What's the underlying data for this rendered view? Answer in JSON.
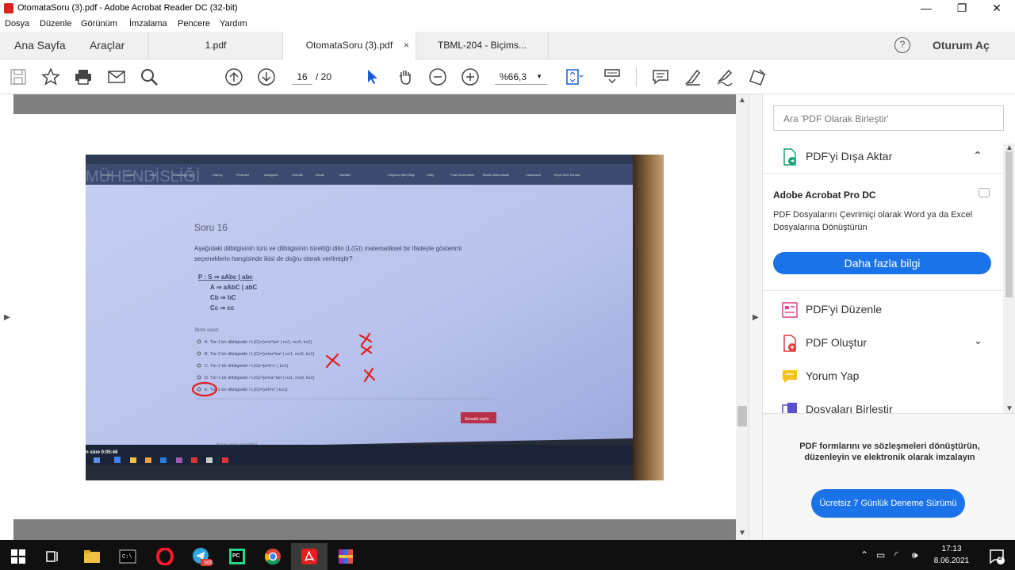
{
  "window": {
    "title": "OtomataSoru (3).pdf - Adobe Acrobat Reader DC (32-bit)",
    "minimize": "—",
    "maximize": "❐",
    "close": "✕"
  },
  "menu": [
    "Dosya",
    "Düzenle",
    "Görünüm",
    "İmzalama",
    "Pencere",
    "Yardım"
  ],
  "nav": {
    "home": "Ana Sayfa",
    "tools": "Araçlar",
    "help": "?",
    "signin": "Oturum Aç"
  },
  "tabs": [
    {
      "label": "1.pdf",
      "active": false
    },
    {
      "label": "OtomataSoru (3).pdf",
      "active": true,
      "close": "×"
    },
    {
      "label": "TBML-204 - Biçims...",
      "active": false
    }
  ],
  "toolbar": {
    "page_current": "16",
    "page_total": "/ 20",
    "zoom": "%66,3"
  },
  "right_panel": {
    "search_placeholder": "Ara 'PDF Olarak Birleştir'",
    "export": "PDF'yi Dışa Aktar",
    "promo_title": "Adobe Acrobat Pro DC",
    "promo_desc": "PDF Dosyalarını Çevrimiçi olarak Word ya da Excel Dosyalarına Dönüştürün",
    "more_button": "Daha fazla bilgi",
    "items": [
      "PDF'yi Düzenle",
      "PDF Oluştur",
      "Yorum Yap",
      "Dosyaları Birleştir"
    ],
    "bottom_text": "PDF formlarını ve sözleşmeleri dönüştürün, düzenleyin ve elektronik olarak imzalayın",
    "trial_button": "Ücretsiz 7 Günlük Deneme Sürümü"
  },
  "photo": {
    "header": "MÜHENDİSLİĞİ",
    "question_title": "Soru 16",
    "question_text": "Aşağıdaki dilbilgisinin türü ve dilbilgisinin türettiği dilin (L(G)) matematiksel bir ifadeyle gösterimi seçeneklerin hangisinde ikisi de doğru olarak verilmiştir?",
    "grammar": [
      "P : S ⇒ aAbc | abc",
      "A ⇒ aAbC | abC",
      "Cb ⇒ bC",
      "Cc ⇒ cc"
    ],
    "choose_label": "Birini seçin:",
    "options": [
      "A. Tür-1 bir dilbilgisidir / L(G)={aⁿaᵐbaᵏ | n≥1, m≥0, k≥1}",
      "B. Tür-2 bir dilbilgisidir / L(G)={aⁿbaᵐbaᵏ | n≥1, m≥0, k≥1}",
      "C. Tür-2 bir dilbilgisidir / L(G)={aⁿbⁿcⁿ | k≥1}",
      "D. Tür-1 bir dilbilgisidir / L(G)={aⁿbaᵐbaᵏ | n≥1, m≥0, k≥1}",
      "E. Tür-1 bir dilbilgisidir / L(G)={aᵏbᵏcᵏ | k≥1}"
    ],
    "next_button": "Sonraki sayfa",
    "footer_note": "Kısa sınav gezintisi",
    "timer": "n süre 0:05:46"
  },
  "taskbar": {
    "time": "17:13",
    "date": "8.06.2021",
    "notification_count": "3",
    "telegram_badge": "965"
  },
  "colors": {
    "accent": "#1a73e8",
    "pdf_red": "#e0201c",
    "viewer_bg": "#7f7f7f",
    "taskbar": "#101010"
  }
}
